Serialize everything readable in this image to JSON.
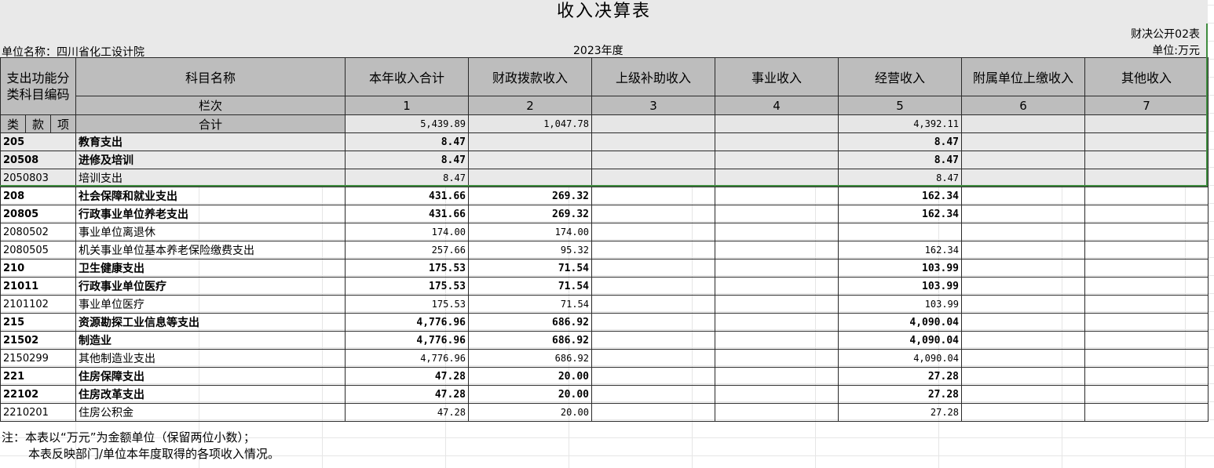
{
  "title": "收入决算表",
  "meta": {
    "form_no": "财决公开02表",
    "unit_name": "单位名称：四川省化工设计院",
    "year": "2023年度",
    "unit": "单位:万元"
  },
  "headers": {
    "code_col": "支出功能分类科目编码",
    "name_col": "科目名称",
    "columns": [
      "本年收入合计",
      "财政拨款收入",
      "上级补助收入",
      "事业收入",
      "经营收入",
      "附属单位上缴收入",
      "其他收入"
    ],
    "row_no_label": "栏次",
    "col_numbers": [
      "1",
      "2",
      "3",
      "4",
      "5",
      "6",
      "7"
    ],
    "lei": "类",
    "kuan": "款",
    "xiang": "项",
    "total_label": "合计",
    "total_values": [
      "5,439.89",
      "1,047.78",
      "",
      "",
      "4,392.11",
      "",
      ""
    ]
  },
  "rows": [
    {
      "code": "205",
      "name": "教育支出",
      "bold": true,
      "values": [
        "8.47",
        "",
        "",
        "",
        "8.47",
        "",
        ""
      ]
    },
    {
      "code": "20508",
      "name": "进修及培训",
      "bold": true,
      "values": [
        "8.47",
        "",
        "",
        "",
        "8.47",
        "",
        ""
      ]
    },
    {
      "code": "2050803",
      "name": "培训支出",
      "bold": false,
      "values": [
        "8.47",
        "",
        "",
        "",
        "8.47",
        "",
        ""
      ]
    },
    {
      "code": "208",
      "name": "社会保障和就业支出",
      "bold": true,
      "values": [
        "431.66",
        "269.32",
        "",
        "",
        "162.34",
        "",
        ""
      ]
    },
    {
      "code": "20805",
      "name": "行政事业单位养老支出",
      "bold": true,
      "values": [
        "431.66",
        "269.32",
        "",
        "",
        "162.34",
        "",
        ""
      ]
    },
    {
      "code": "2080502",
      "name": "事业单位离退休",
      "bold": false,
      "values": [
        "174.00",
        "174.00",
        "",
        "",
        "",
        "",
        ""
      ]
    },
    {
      "code": "2080505",
      "name": "机关事业单位基本养老保险缴费支出",
      "bold": false,
      "values": [
        "257.66",
        "95.32",
        "",
        "",
        "162.34",
        "",
        ""
      ]
    },
    {
      "code": "210",
      "name": "卫生健康支出",
      "bold": true,
      "values": [
        "175.53",
        "71.54",
        "",
        "",
        "103.99",
        "",
        ""
      ]
    },
    {
      "code": "21011",
      "name": "行政事业单位医疗",
      "bold": true,
      "values": [
        "175.53",
        "71.54",
        "",
        "",
        "103.99",
        "",
        ""
      ]
    },
    {
      "code": "2101102",
      "name": "事业单位医疗",
      "bold": false,
      "values": [
        "175.53",
        "71.54",
        "",
        "",
        "103.99",
        "",
        ""
      ]
    },
    {
      "code": "215",
      "name": "资源勘探工业信息等支出",
      "bold": true,
      "values": [
        "4,776.96",
        "686.92",
        "",
        "",
        "4,090.04",
        "",
        ""
      ]
    },
    {
      "code": "21502",
      "name": "制造业",
      "bold": true,
      "values": [
        "4,776.96",
        "686.92",
        "",
        "",
        "4,090.04",
        "",
        ""
      ]
    },
    {
      "code": "2150299",
      "name": "其他制造业支出",
      "bold": false,
      "values": [
        "4,776.96",
        "686.92",
        "",
        "",
        "4,090.04",
        "",
        ""
      ]
    },
    {
      "code": "221",
      "name": "住房保障支出",
      "bold": true,
      "values": [
        "47.28",
        "20.00",
        "",
        "",
        "27.28",
        "",
        ""
      ]
    },
    {
      "code": "22102",
      "name": "住房改革支出",
      "bold": true,
      "values": [
        "47.28",
        "20.00",
        "",
        "",
        "27.28",
        "",
        ""
      ]
    },
    {
      "code": "2210201",
      "name": "住房公积金",
      "bold": false,
      "values": [
        "47.28",
        "20.00",
        "",
        "",
        "27.28",
        "",
        ""
      ]
    }
  ],
  "notes": [
    "注：本表以“万元”为金额单位（保留两位小数）；",
    "本表反映部门/单位本年度取得的各项收入情况。"
  ]
}
